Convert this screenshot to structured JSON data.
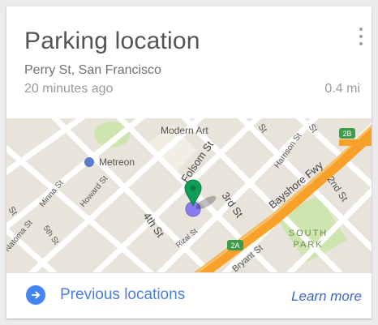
{
  "card": {
    "title": "Parking location",
    "address": "Perry St, San Francisco",
    "age": "20 minutes ago",
    "distance": "0.4 mi",
    "menu_icon": "more-vert-icon"
  },
  "map": {
    "labels": {
      "modern_art": "Modern Art",
      "metreon": "Metreon",
      "folsom": "Folsom St",
      "third": "3rd St",
      "fourth": "4th St",
      "bayshore": "Bayshore Fwy",
      "harrison": "Harrison St",
      "second": "2nd St",
      "howard": "Howard St",
      "minna": "Minna St",
      "fifth": "5th St",
      "natoma": "Natoma St",
      "rizal": "Rizal St",
      "bryant": "Bryant St",
      "south_park_1": "SOUTH",
      "south_park_2": "PARK",
      "shield_2b": "2B",
      "shield_2a": "2A",
      "edge_st_1": "St",
      "edge_st_2": "St",
      "edge_st_3": "St"
    },
    "colors": {
      "freeway": "#f7a12b",
      "park": "#cfe5b0",
      "pin": "#0f9d58",
      "location": "#8a7cf0"
    }
  },
  "footer": {
    "previous_label": "Previous locations",
    "previous_icon": "arrow-right-circle-icon",
    "learn_more": "Learn more"
  }
}
